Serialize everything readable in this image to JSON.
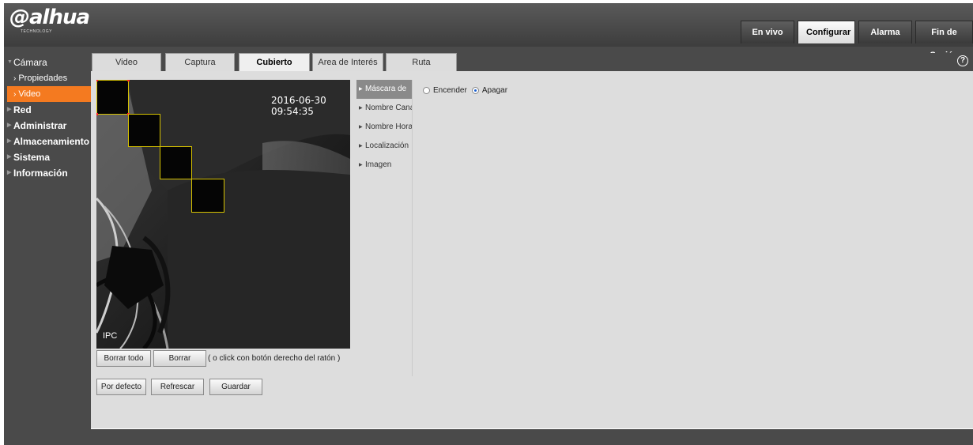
{
  "header": {
    "logo_text": "alhua",
    "logo_sub": "TECHNOLOGY",
    "tabs": [
      {
        "label": "En vivo",
        "active": false
      },
      {
        "label": "Configurar",
        "active": true
      },
      {
        "label": "Alarma",
        "active": false
      },
      {
        "label": "Fin de Sesión",
        "active": false
      }
    ]
  },
  "sidebar": {
    "groups": [
      {
        "label": "Cámara",
        "expanded": true,
        "items": [
          {
            "label": "Propiedades",
            "active": false
          },
          {
            "label": "Video",
            "active": true
          }
        ]
      },
      {
        "label": "Red",
        "expanded": false
      },
      {
        "label": "Administrar",
        "expanded": false
      },
      {
        "label": "Almacenamiento",
        "expanded": false
      },
      {
        "label": "Sistema",
        "expanded": false
      },
      {
        "label": "Información",
        "expanded": false
      }
    ]
  },
  "sub_tabs": [
    {
      "label": "Video",
      "active": false
    },
    {
      "label": "Captura",
      "active": false
    },
    {
      "label": "Cubierto",
      "active": true
    },
    {
      "label": "Area de Interés",
      "active": false
    },
    {
      "label": "Ruta",
      "active": false
    }
  ],
  "help_icon": "?",
  "preview": {
    "timestamp": "2016-06-30 09:54:35",
    "channel_name": "IPC",
    "mask_count": 4
  },
  "buttons": {
    "clear_all": "Borrar todo",
    "clear": "Borrar",
    "hint": "( o click con botón derecho del ratón )",
    "default": "Por defecto",
    "refresh": "Refrescar",
    "save": "Guardar"
  },
  "menu": {
    "items": [
      {
        "label": "Máscara de",
        "active": true
      },
      {
        "label": "Nombre Canal",
        "active": false
      },
      {
        "label": "Nombre Horario",
        "active": false
      },
      {
        "label": "Localización",
        "active": false
      },
      {
        "label": "Imagen",
        "active": false
      }
    ]
  },
  "privacy_mask": {
    "options": [
      "Encender",
      "Apagar"
    ],
    "selected": "Apagar"
  },
  "colors": {
    "accent": "#f47a20",
    "mask_border": "#d6c200",
    "header_bg": "#4a4a4a"
  }
}
